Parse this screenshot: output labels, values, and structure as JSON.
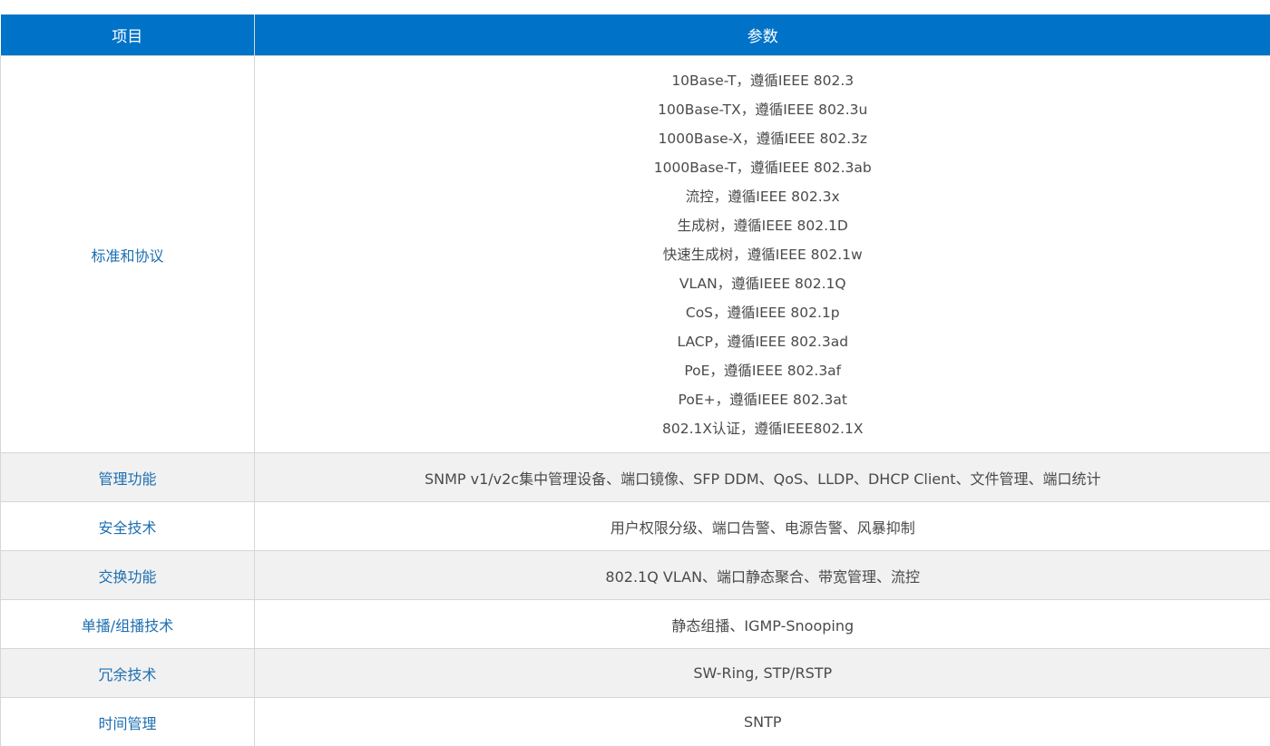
{
  "header": {
    "col_item": "项目",
    "col_param": "参数"
  },
  "rows": [
    {
      "item": "标准和协议",
      "params": [
        "10Base-T，遵循IEEE 802.3",
        "100Base-TX，遵循IEEE 802.3u",
        "1000Base-X，遵循IEEE 802.3z",
        "1000Base-T，遵循IEEE 802.3ab",
        "流控，遵循IEEE 802.3x",
        "生成树，遵循IEEE 802.1D",
        "快速生成树，遵循IEEE 802.1w",
        "VLAN，遵循IEEE 802.1Q",
        "CoS，遵循IEEE 802.1p",
        "LACP，遵循IEEE 802.3ad",
        "PoE，遵循IEEE 802.3af",
        "PoE+，遵循IEEE 802.3at",
        "802.1X认证，遵循IEEE802.1X"
      ]
    },
    {
      "item": "管理功能",
      "param": "SNMP v1/v2c集中管理设备、端口镜像、SFP DDM、QoS、LLDP、DHCP Client、文件管理、端口统计"
    },
    {
      "item": "安全技术",
      "param": "用户权限分级、端口告警、电源告警、风暴抑制"
    },
    {
      "item": "交换功能",
      "param": "802.1Q VLAN、端口静态聚合、带宽管理、流控"
    },
    {
      "item": "单播/组播技术",
      "param": "静态组播、IGMP-Snooping"
    },
    {
      "item": "冗余技术",
      "param": "SW-Ring, STP/RSTP"
    },
    {
      "item": "时间管理",
      "param": "SNTP"
    }
  ],
  "colors": {
    "header_bg": "#0073c8",
    "item_text": "#1d6fb0",
    "param_text": "#4a4a4a",
    "stripe_bg": "#f1f1f1"
  }
}
